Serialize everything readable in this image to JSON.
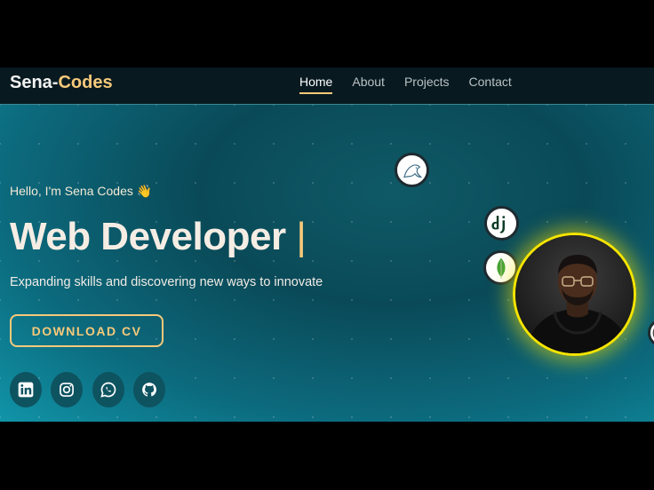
{
  "nav": {
    "logo_main": "Sena-",
    "logo_accent": "Codes",
    "links": [
      "Home",
      "About",
      "Projects",
      "Contact"
    ],
    "active": "Home"
  },
  "hero": {
    "greeting": "Hello, I'm Sena Codes 👋",
    "headline": "Web Developer",
    "cursor": "|",
    "tagline": "Expanding skills and discovering new ways to innovate",
    "cv_button": "DOWNLOAD CV"
  },
  "social_icons": [
    "linkedin-icon",
    "instagram-icon",
    "whatsapp-icon",
    "github-icon"
  ],
  "tech_icons": [
    "mysql-icon",
    "django-icon",
    "mongodb-icon",
    "wordpress-icon"
  ],
  "colors": {
    "accent": "#f7c97a",
    "avatar_ring": "#f5e400",
    "nav_bg": "#081a20",
    "hero_bg": "#0c6a7d"
  }
}
